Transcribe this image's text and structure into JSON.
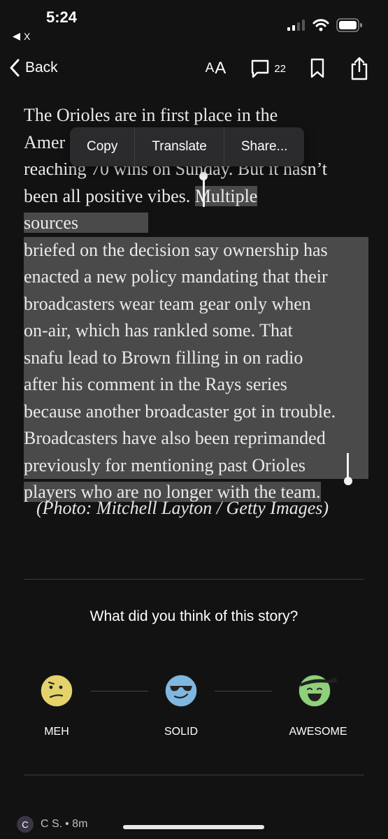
{
  "status_bar": {
    "time": "5:24",
    "back_app": "X"
  },
  "nav": {
    "back_label": "Back",
    "font_size_big": "A",
    "font_size_small": "A",
    "comment_count": "22"
  },
  "article": {
    "lines": [
      {
        "text": "The Orioles are in first place in the",
        "selected": false
      },
      {
        "text": "Amer",
        "selected": false,
        "hidden_under_menu": true
      },
      {
        "text": "reaching 70 wins on Sunday. But it hasn’t",
        "selected": false,
        "clipped_top": true
      },
      {
        "pre": "been all positive vibes. ",
        "text": "Multiple sources",
        "selected": true
      },
      {
        "text": "briefed on the decision say ownership has",
        "selected": true
      },
      {
        "text": "enacted a new policy mandating that their",
        "selected": true
      },
      {
        "text": "broadcasters wear team gear only when",
        "selected": true
      },
      {
        "text": "on-air, which has rankled some. That",
        "selected": true
      },
      {
        "text": "snafu lead to Brown filling in on radio",
        "selected": true
      },
      {
        "text": "after his comment in the Rays series",
        "selected": true
      },
      {
        "text": "because another broadcaster got in trouble.",
        "selected": true
      },
      {
        "text": "Broadcasters have also been reprimanded",
        "selected": true
      },
      {
        "text": "previously for mentioning past Orioles",
        "selected": true
      },
      {
        "text": "players who are no longer with the team.",
        "selected": true
      }
    ],
    "caption": "(Photo: Mitchell Layton / Getty Images)"
  },
  "context_menu": {
    "copy": "Copy",
    "translate": "Translate",
    "share": "Share..."
  },
  "feedback": {
    "question": "What did you think of this story?",
    "options": [
      {
        "label": "MEH",
        "icon": "meh-face-icon",
        "color": "#e3d36a"
      },
      {
        "label": "SOLID",
        "icon": "sunglasses-face-icon",
        "color": "#7fb7e0"
      },
      {
        "label": "AWESOME",
        "icon": "party-face-icon",
        "color": "#8fd07a"
      }
    ]
  },
  "bottom": {
    "avatar_letter": "C",
    "user": "C S.",
    "time": "• 8m"
  },
  "colors": {
    "background": "#121212",
    "selection": "#4a4a4a",
    "text": "#eaeaea"
  }
}
